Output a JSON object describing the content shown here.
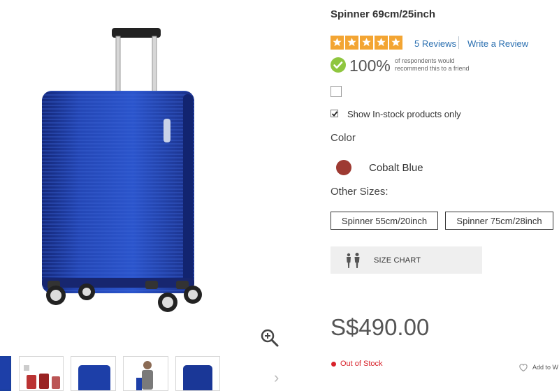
{
  "product": {
    "title": "Spinner 69cm/25inch",
    "image_alt": "suitcase",
    "price": "S$490.00",
    "stock_status": "Out of Stock"
  },
  "reviews": {
    "rating": 5,
    "count_label": "5 Reviews",
    "write_label": "Write a Review",
    "recommend_percent": "100%",
    "recommend_text_line1": "of respondents would",
    "recommend_text_line2": "recommend this to a friend"
  },
  "filters": {
    "instock_label": "Show In-stock products only",
    "instock_checked": true
  },
  "color": {
    "heading": "Color",
    "selected_name": "Cobalt Blue",
    "swatch_hex": "#9e3a32"
  },
  "sizes": {
    "heading": "Other Sizes:",
    "options": [
      "Spinner 55cm/20inch",
      "Spinner 75cm/28inch"
    ]
  },
  "size_chart": {
    "label": "SIZE CHART"
  },
  "wishlist": {
    "label": "Add to W"
  },
  "colors": {
    "accent_link": "#2a6fb0",
    "star_bg": "#f3a533",
    "out_of_stock": "#d8222a",
    "suitcase_blue": "#1d3fa8"
  },
  "thumbnails": [
    {
      "name": "thumb-1"
    },
    {
      "name": "thumb-2"
    },
    {
      "name": "thumb-3"
    },
    {
      "name": "thumb-4"
    },
    {
      "name": "thumb-5"
    }
  ]
}
